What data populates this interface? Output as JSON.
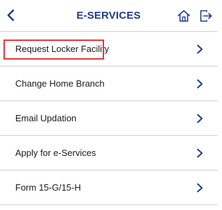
{
  "header": {
    "title": "E-SERVICES",
    "accent_color": "#1e3c8c",
    "back_icon": "chevron-left-icon",
    "home_icon": "home-icon",
    "logout_icon": "logout-icon"
  },
  "menu": {
    "items": [
      {
        "label": "Request Locker Facility",
        "icon": "chevron-right-icon"
      },
      {
        "label": "Change Home Branch",
        "icon": "chevron-right-icon",
        "highlighted": true
      },
      {
        "label": "Email Updation",
        "icon": "chevron-right-icon"
      },
      {
        "label": "Apply for e-Services",
        "icon": "chevron-right-icon"
      },
      {
        "label": "Form 15-G/15-H",
        "icon": "chevron-right-icon"
      }
    ]
  },
  "highlight": {
    "color": "#e0393e"
  }
}
